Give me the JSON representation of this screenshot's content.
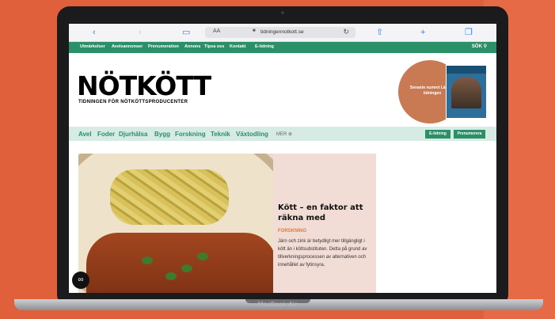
{
  "browser": {
    "address_text": "tidningennotkott.se",
    "aa_label": "AA"
  },
  "top_nav": {
    "items": [
      "Utmärkelser",
      "Avelsannonser",
      "Prenumeration",
      "Annons",
      "Tipsa oss",
      "Kontakt",
      "E-tidning"
    ],
    "search_label": "SÖK"
  },
  "header": {
    "logo": "NÖTKÖTT",
    "tagline": "TIDNINGEN FÖR NÖTKÖTTSPRODUCENTER",
    "promo_text": "Senaste numret Läs i e-tidningen"
  },
  "section_nav": {
    "items": [
      "Avel",
      "Foder",
      "Djurhälsa",
      "Bygg",
      "Forskning",
      "Teknik",
      "Växtodling"
    ],
    "more_label": "MER",
    "buttons": [
      "E-tidning",
      "Prenumerera"
    ]
  },
  "article": {
    "title": "Kött – en faktor att räkna med",
    "category": "FORSKNING",
    "excerpt": "Järn och zink är betydligt mer tillgängligt i kött än i köttsubstituten. Detta på grund av tillverkningsprocessen av alternativen och innehållet av fytinsyra."
  },
  "device": {
    "label": "MacBook Air"
  },
  "colors": {
    "brand_green": "#2b8f68",
    "mint": "#d6ebe3",
    "card_pink": "#f2dcd6",
    "category_orange": "#e07a3c",
    "background": "#e0603c"
  }
}
